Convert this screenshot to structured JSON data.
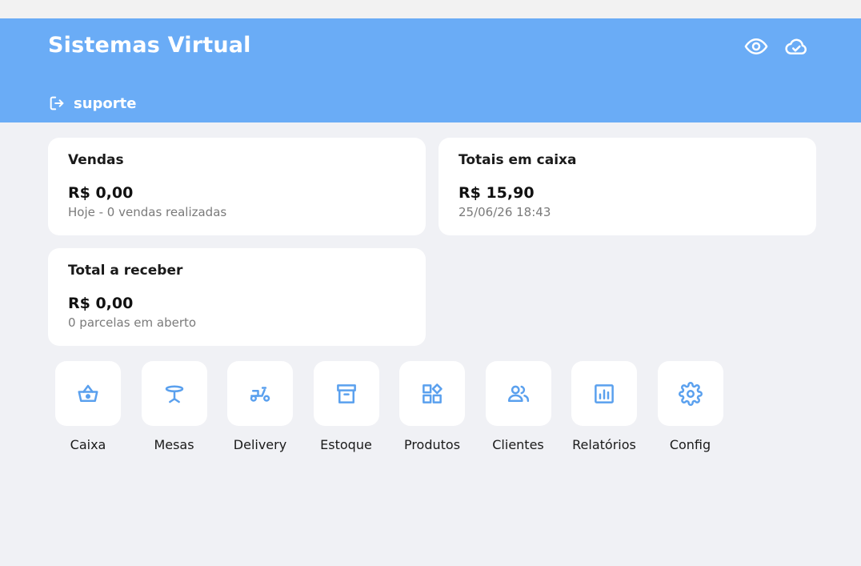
{
  "header": {
    "title": "Sistemas Virtual",
    "support_label": "suporte",
    "icons": [
      "eye-icon",
      "cloud-check-icon",
      "logout-icon"
    ],
    "background_color": "#6aacf6"
  },
  "cards": {
    "vendas": {
      "title": "Vendas",
      "value": "R$ 0,00",
      "subtitle": "Hoje - 0 vendas realizadas"
    },
    "caixa": {
      "title": "Totais em caixa",
      "value": "R$ 15,90",
      "subtitle": "25/06/26 18:43"
    },
    "receber": {
      "title": "Total a receber",
      "value": "R$ 0,00",
      "subtitle": "0 parcelas em aberto"
    }
  },
  "shortcuts": [
    {
      "label": "Caixa",
      "icon": "basket-icon"
    },
    {
      "label": "Mesas",
      "icon": "table-icon"
    },
    {
      "label": "Delivery",
      "icon": "scooter-icon"
    },
    {
      "label": "Estoque",
      "icon": "archive-icon"
    },
    {
      "label": "Produtos",
      "icon": "widgets-icon"
    },
    {
      "label": "Clientes",
      "icon": "users-icon"
    },
    {
      "label": "Relatórios",
      "icon": "chart-icon"
    },
    {
      "label": "Config",
      "icon": "gear-icon"
    }
  ],
  "colors": {
    "accent": "#6aacf6",
    "background": "#f0f1f5",
    "card": "#ffffff"
  }
}
